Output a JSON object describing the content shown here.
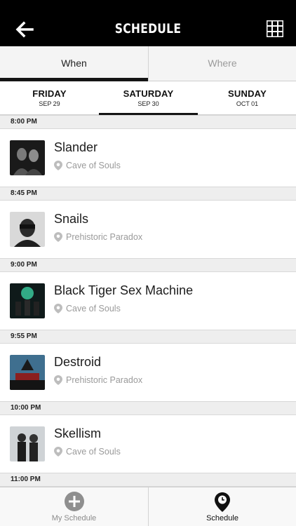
{
  "header": {
    "title": "SCHEDULE",
    "back_icon": "arrow-left-icon",
    "grid_icon": "grid-icon"
  },
  "segmented": {
    "options": [
      {
        "label": "When",
        "selected": true
      },
      {
        "label": "Where",
        "selected": false
      }
    ]
  },
  "days": [
    {
      "name": "FRIDAY",
      "date": "SEP 29",
      "selected": false
    },
    {
      "name": "SATURDAY",
      "date": "SEP 30",
      "selected": true
    },
    {
      "name": "SUNDAY",
      "date": "OCT 01",
      "selected": false
    }
  ],
  "schedule": [
    {
      "time": "8:00 PM",
      "artist": "Slander",
      "venue": "Cave of Souls"
    },
    {
      "time": "8:45 PM",
      "artist": "Snails",
      "venue": "Prehistoric Paradox"
    },
    {
      "time": "9:00 PM",
      "artist": "Black Tiger Sex Machine",
      "venue": "Cave of Souls"
    },
    {
      "time": "9:55 PM",
      "artist": "Destroid",
      "venue": "Prehistoric Paradox"
    },
    {
      "time": "10:00 PM",
      "artist": "Skellism",
      "venue": "Cave of Souls"
    },
    {
      "time": "11:00 PM"
    }
  ],
  "tabbar": {
    "tabs": [
      {
        "label": "My Schedule",
        "icon": "plus-circle-icon",
        "selected": false
      },
      {
        "label": "Schedule",
        "icon": "map-pin-icon",
        "selected": true
      }
    ]
  },
  "colors": {
    "header_bg": "#000000",
    "active_indicator": "#141414",
    "muted_text": "#9a9a9a"
  }
}
